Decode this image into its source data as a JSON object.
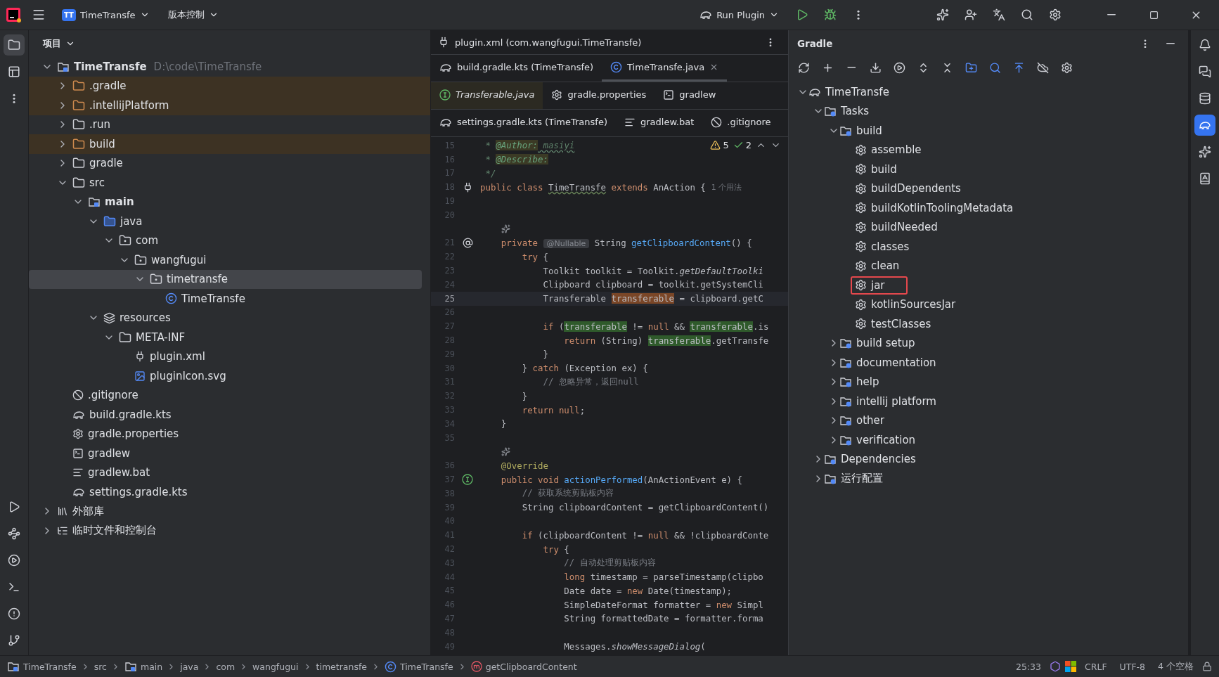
{
  "title_bar": {
    "project_badge": "TT",
    "project": "TimeTransfe",
    "vcs": "版本控制",
    "run_config": "Run Plugin"
  },
  "left_stripe": [
    {
      "kind": "project",
      "selected": true
    },
    {
      "kind": "structure",
      "selected": false
    },
    {
      "kind": "more",
      "selected": false
    }
  ],
  "left_stripe_bottom": [
    {
      "kind": "run",
      "selected": false
    },
    {
      "kind": "services",
      "selected": false
    },
    {
      "kind": "debug",
      "selected": false
    },
    {
      "kind": "terminal",
      "selected": false
    },
    {
      "kind": "problems",
      "selected": false
    },
    {
      "kind": "git",
      "selected": false
    }
  ],
  "project_panel": {
    "title": "项目",
    "tree": [
      {
        "label": "TimeTransfe",
        "kind": "module",
        "path": "D:\\code\\TimeTransfe",
        "expanded": true,
        "selected": false,
        "excluded": false,
        "children": [
          {
            "label": ".gradle",
            "kind": "folder",
            "expanded": false,
            "selected": false,
            "excluded": true
          },
          {
            "label": ".intellijPlatform",
            "kind": "folder",
            "expanded": false,
            "selected": false,
            "excluded": true
          },
          {
            "label": ".run",
            "kind": "folder",
            "expanded": false,
            "selected": false,
            "excluded": false
          },
          {
            "label": "build",
            "kind": "folder",
            "expanded": false,
            "selected": false,
            "excluded": true
          },
          {
            "label": "gradle",
            "kind": "folder",
            "expanded": false,
            "selected": false,
            "excluded": false
          },
          {
            "label": "src",
            "kind": "folder",
            "expanded": true,
            "selected": false,
            "excluded": false,
            "children": [
              {
                "label": "main",
                "kind": "module",
                "expanded": true,
                "selected": false,
                "excluded": false,
                "children": [
                  {
                    "label": "java",
                    "kind": "source",
                    "expanded": true,
                    "selected": false,
                    "excluded": false,
                    "children": [
                      {
                        "label": "com",
                        "kind": "package",
                        "expanded": true,
                        "selected": false,
                        "excluded": false,
                        "children": [
                          {
                            "label": "wangfugui",
                            "kind": "package",
                            "expanded": true,
                            "selected": false,
                            "excluded": false,
                            "children": [
                              {
                                "label": "timetransfe",
                                "kind": "package",
                                "expanded": true,
                                "selected": true,
                                "excluded": false,
                                "children": [
                                  {
                                    "label": "TimeTransfe",
                                    "kind": "class",
                                    "selected": false,
                                    "excluded": false
                                  }
                                ]
                              }
                            ]
                          }
                        ]
                      }
                    ]
                  },
                  {
                    "label": "resources",
                    "kind": "resources",
                    "expanded": true,
                    "selected": false,
                    "excluded": false,
                    "children": [
                      {
                        "label": "META-INF",
                        "kind": "folder",
                        "expanded": true,
                        "selected": false,
                        "excluded": false,
                        "children": [
                          {
                            "label": "plugin.xml",
                            "kind": "plugin",
                            "selected": false,
                            "excluded": false
                          },
                          {
                            "label": "pluginIcon.svg",
                            "kind": "image",
                            "selected": false,
                            "excluded": false
                          }
                        ]
                      }
                    ]
                  }
                ]
              }
            ]
          },
          {
            "label": ".gitignore",
            "kind": "ignore",
            "selected": false,
            "excluded": false
          },
          {
            "label": "build.gradle.kts",
            "kind": "gradle",
            "selected": false,
            "excluded": false
          },
          {
            "label": "gradle.properties",
            "kind": "settings",
            "selected": false,
            "excluded": false
          },
          {
            "label": "gradlew",
            "kind": "terminal",
            "selected": false,
            "excluded": false
          },
          {
            "label": "gradlew.bat",
            "kind": "text",
            "selected": false,
            "excluded": false
          },
          {
            "label": "settings.gradle.kts",
            "kind": "gradle",
            "selected": false,
            "excluded": false
          }
        ]
      },
      {
        "label": "外部库",
        "kind": "library",
        "expanded": false,
        "selected": false,
        "excluded": false
      },
      {
        "label": "临时文件和控制台",
        "kind": "scratch",
        "expanded": false,
        "selected": false,
        "excluded": false
      }
    ]
  },
  "editor": {
    "file_path": "plugin.xml (com.wangfugui.TimeTransfe)",
    "tab_rows": [
      [
        {
          "label": "build.gradle.kts (TimeTransfe)",
          "kind": "gradle",
          "selected": false,
          "preview": false
        },
        {
          "label": "TimeTransfe.java",
          "kind": "class",
          "selected": true,
          "preview": false
        }
      ],
      [
        {
          "label": "Transferable.java",
          "kind": "interface",
          "selected": false,
          "preview": true
        },
        {
          "label": "gradle.properties",
          "kind": "settings",
          "selected": false,
          "preview": false
        },
        {
          "label": "gradlew",
          "kind": "terminal",
          "selected": false,
          "preview": false
        }
      ],
      [
        {
          "label": "settings.gradle.kts (TimeTransfe)",
          "kind": "gradle",
          "selected": false,
          "preview": false
        },
        {
          "label": "gradlew.bat",
          "kind": "text",
          "selected": false,
          "preview": false
        },
        {
          "label": ".gitignore",
          "kind": "ignore",
          "selected": false,
          "preview": false
        }
      ]
    ],
    "inspections": {
      "warnings": "5",
      "weak_warnings": "2"
    },
    "lines": [
      {
        "kind": "code",
        "number": "15",
        "current": false,
        "segments": [
          {
            "kind": "doc",
            "text": " * "
          },
          {
            "kind": "doctag",
            "text": "@Author:"
          },
          {
            "kind": "typo",
            "text": " masiyi"
          }
        ]
      },
      {
        "kind": "code",
        "number": "16",
        "current": false,
        "segments": [
          {
            "kind": "doc",
            "text": " * "
          },
          {
            "kind": "doctag",
            "text": "@Describe:"
          }
        ]
      },
      {
        "kind": "code",
        "number": "17",
        "current": false,
        "segments": [
          {
            "kind": "doc",
            "text": " */"
          }
        ]
      },
      {
        "kind": "code",
        "number": "18",
        "current": false,
        "marker": {
          "kind": "plug"
        },
        "segments": [
          {
            "kind": "kw",
            "text": "public class "
          },
          {
            "kind": "typo-plain",
            "text": "TimeTransfe"
          },
          {
            "kind": "kw",
            "text": " extends "
          },
          {
            "kind": "plain",
            "text": "AnAction {"
          }
        ],
        "usage": "1 个用法"
      },
      {
        "kind": "code",
        "number": "19",
        "current": false
      },
      {
        "kind": "code",
        "number": "20",
        "current": false
      },
      {
        "kind": "inlay"
      },
      {
        "kind": "code",
        "number": "21",
        "current": false,
        "marker": {
          "kind": "at"
        },
        "segments": [
          {
            "kind": "kw",
            "text": "    private "
          },
          {
            "kind": "hint",
            "text": "@Nullable"
          },
          {
            "kind": "plain",
            "text": " String "
          },
          {
            "kind": "method",
            "text": "getClipboardContent"
          },
          {
            "kind": "plain",
            "text": "() {"
          }
        ]
      },
      {
        "kind": "code",
        "number": "22",
        "current": false,
        "segments": [
          {
            "kind": "kw",
            "text": "        try "
          },
          {
            "kind": "plain",
            "text": "{"
          }
        ]
      },
      {
        "kind": "code",
        "number": "23",
        "current": false,
        "segments": [
          {
            "kind": "plain",
            "text": "            Toolkit toolkit = Toolkit."
          },
          {
            "kind": "static",
            "text": "getDefaultToolki"
          }
        ]
      },
      {
        "kind": "code",
        "number": "24",
        "current": false,
        "segments": [
          {
            "kind": "plain",
            "text": "            Clipboard clipboard = toolkit.getSystemCli"
          }
        ]
      },
      {
        "kind": "code",
        "number": "25",
        "current": true,
        "segments": [
          {
            "kind": "plain",
            "text": "            Transferable "
          },
          {
            "kind": "write",
            "text": "transferable"
          },
          {
            "kind": "plain",
            "text": " = clipboard.getC"
          }
        ]
      },
      {
        "kind": "code",
        "number": "26",
        "current": false
      },
      {
        "kind": "code",
        "number": "27",
        "current": false,
        "segments": [
          {
            "kind": "kw",
            "text": "            if "
          },
          {
            "kind": "plain",
            "text": "("
          },
          {
            "kind": "read",
            "text": "transferable"
          },
          {
            "kind": "plain",
            "text": " != "
          },
          {
            "kind": "kw",
            "text": "null"
          },
          {
            "kind": "plain",
            "text": " && "
          },
          {
            "kind": "read",
            "text": "transferable"
          },
          {
            "kind": "plain",
            "text": ".is"
          }
        ]
      },
      {
        "kind": "code",
        "number": "28",
        "current": false,
        "segments": [
          {
            "kind": "kw",
            "text": "                return "
          },
          {
            "kind": "plain",
            "text": "(String) "
          },
          {
            "kind": "read",
            "text": "transferable"
          },
          {
            "kind": "plain",
            "text": ".getTransfe"
          }
        ]
      },
      {
        "kind": "code",
        "number": "29",
        "current": false,
        "segments": [
          {
            "kind": "plain",
            "text": "            }"
          }
        ]
      },
      {
        "kind": "code",
        "number": "30",
        "current": false,
        "segments": [
          {
            "kind": "plain",
            "text": "        } "
          },
          {
            "kind": "kw",
            "text": "catch "
          },
          {
            "kind": "plain",
            "text": "(Exception ex) {"
          }
        ]
      },
      {
        "kind": "code",
        "number": "31",
        "current": false,
        "segments": [
          {
            "kind": "comment",
            "text": "            // 忽略异常，返回null"
          }
        ]
      },
      {
        "kind": "code",
        "number": "32",
        "current": false,
        "segments": [
          {
            "kind": "plain",
            "text": "        }"
          }
        ]
      },
      {
        "kind": "code",
        "number": "33",
        "current": false,
        "segments": [
          {
            "kind": "kw",
            "text": "        return null"
          },
          {
            "kind": "plain",
            "text": ";"
          }
        ]
      },
      {
        "kind": "code",
        "number": "34",
        "current": false,
        "segments": [
          {
            "kind": "plain",
            "text": "    }"
          }
        ]
      },
      {
        "kind": "code",
        "number": "35",
        "current": false
      },
      {
        "kind": "inlay"
      },
      {
        "kind": "code",
        "number": "36",
        "current": false,
        "segments": [
          {
            "kind": "annotation",
            "text": "    @Override"
          }
        ]
      },
      {
        "kind": "code",
        "number": "37",
        "current": false,
        "marker": {
          "kind": "implements"
        },
        "segments": [
          {
            "kind": "kw",
            "text": "    public void "
          },
          {
            "kind": "method",
            "text": "actionPerformed"
          },
          {
            "kind": "plain",
            "text": "(AnActionEvent e) {"
          }
        ]
      },
      {
        "kind": "code",
        "number": "38",
        "current": false,
        "segments": [
          {
            "kind": "comment",
            "text": "        // 获取系统剪贴板内容"
          }
        ]
      },
      {
        "kind": "code",
        "number": "39",
        "current": false,
        "segments": [
          {
            "kind": "plain",
            "text": "        String clipboardContent = getClipboardContent()"
          }
        ]
      },
      {
        "kind": "code",
        "number": "40",
        "current": false
      },
      {
        "kind": "code",
        "number": "41",
        "current": false,
        "segments": [
          {
            "kind": "kw",
            "text": "        if "
          },
          {
            "kind": "plain",
            "text": "(clipboardContent != "
          },
          {
            "kind": "kw",
            "text": "null"
          },
          {
            "kind": "plain",
            "text": " && !clipboardConte"
          }
        ]
      },
      {
        "kind": "code",
        "number": "42",
        "current": false,
        "segments": [
          {
            "kind": "kw",
            "text": "            try "
          },
          {
            "kind": "plain",
            "text": "{"
          }
        ]
      },
      {
        "kind": "code",
        "number": "43",
        "current": false,
        "segments": [
          {
            "kind": "comment",
            "text": "                // 自动处理剪贴板内容"
          }
        ]
      },
      {
        "kind": "code",
        "number": "44",
        "current": false,
        "segments": [
          {
            "kind": "kw",
            "text": "                long "
          },
          {
            "kind": "plain",
            "text": "timestamp = parseTimestamp(clipbo"
          }
        ]
      },
      {
        "kind": "code",
        "number": "45",
        "current": false,
        "segments": [
          {
            "kind": "plain",
            "text": "                Date date = "
          },
          {
            "kind": "kw",
            "text": "new "
          },
          {
            "kind": "plain",
            "text": "Date(timestamp);"
          }
        ]
      },
      {
        "kind": "code",
        "number": "46",
        "current": false,
        "segments": [
          {
            "kind": "plain",
            "text": "                SimpleDateFormat formatter = "
          },
          {
            "kind": "kw",
            "text": "new "
          },
          {
            "kind": "plain",
            "text": "Simpl"
          }
        ]
      },
      {
        "kind": "code",
        "number": "47",
        "current": false,
        "segments": [
          {
            "kind": "plain",
            "text": "                String formattedDate = formatter.forma"
          }
        ]
      },
      {
        "kind": "code",
        "number": "48",
        "current": false
      },
      {
        "kind": "code",
        "number": "49",
        "current": false,
        "segments": [
          {
            "kind": "plain",
            "text": "                Messages."
          },
          {
            "kind": "static",
            "text": "showMessageDialog"
          },
          {
            "kind": "plain",
            "text": "("
          }
        ]
      }
    ]
  },
  "gradle_panel": {
    "title": "Gradle",
    "tree": [
      {
        "label": "TimeTransfe",
        "kind": "project",
        "expanded": true,
        "selected": false,
        "outlined": false,
        "children": [
          {
            "label": "Tasks",
            "kind": "group",
            "expanded": true,
            "selected": false,
            "outlined": false,
            "children": [
              {
                "label": "build",
                "kind": "group",
                "expanded": true,
                "selected": false,
                "outlined": false,
                "children": [
                  {
                    "label": "assemble",
                    "kind": "task",
                    "selected": false,
                    "outlined": false
                  },
                  {
                    "label": "build",
                    "kind": "task",
                    "selected": false,
                    "outlined": false
                  },
                  {
                    "label": "buildDependents",
                    "kind": "task",
                    "selected": false,
                    "outlined": false
                  },
                  {
                    "label": "buildKotlinToolingMetadata",
                    "kind": "task",
                    "selected": false,
                    "outlined": false
                  },
                  {
                    "label": "buildNeeded",
                    "kind": "task",
                    "selected": false,
                    "outlined": false
                  },
                  {
                    "label": "classes",
                    "kind": "task",
                    "selected": false,
                    "outlined": false
                  },
                  {
                    "label": "clean",
                    "kind": "task",
                    "selected": false,
                    "outlined": false
                  },
                  {
                    "label": "jar",
                    "kind": "task",
                    "selected": false,
                    "outlined": true
                  },
                  {
                    "label": "kotlinSourcesJar",
                    "kind": "task",
                    "selected": false,
                    "outlined": false
                  },
                  {
                    "label": "testClasses",
                    "kind": "task",
                    "selected": false,
                    "outlined": false
                  }
                ]
              },
              {
                "label": "build setup",
                "kind": "group",
                "expanded": false,
                "selected": false,
                "outlined": false
              },
              {
                "label": "documentation",
                "kind": "group",
                "expanded": false,
                "selected": false,
                "outlined": false
              },
              {
                "label": "help",
                "kind": "group",
                "expanded": false,
                "selected": false,
                "outlined": false
              },
              {
                "label": "intellij platform",
                "kind": "group",
                "expanded": false,
                "selected": false,
                "outlined": false
              },
              {
                "label": "other",
                "kind": "group",
                "expanded": false,
                "selected": false,
                "outlined": false
              },
              {
                "label": "verification",
                "kind": "group",
                "expanded": false,
                "selected": false,
                "outlined": false
              }
            ]
          },
          {
            "label": "Dependencies",
            "kind": "group",
            "expanded": false,
            "selected": false,
            "outlined": false
          },
          {
            "label": "运行配置",
            "kind": "group",
            "expanded": false,
            "selected": false,
            "outlined": false
          }
        ]
      }
    ]
  },
  "right_stripe": [
    {
      "kind": "notifications",
      "selected": false
    },
    {
      "kind": "chat",
      "selected": false
    },
    {
      "kind": "database",
      "selected": false
    },
    {
      "kind": "gradle",
      "selected": true
    },
    {
      "kind": "ai",
      "selected": false
    },
    {
      "kind": "docs",
      "selected": false
    }
  ],
  "status_bar": {
    "breadcrumbs": [
      {
        "label": "TimeTransfe",
        "kind": "module"
      },
      {
        "label": "src",
        "kind": "plain"
      },
      {
        "label": "main",
        "kind": "module"
      },
      {
        "label": "java",
        "kind": "plain"
      },
      {
        "label": "com",
        "kind": "plain"
      },
      {
        "label": "wangfugui",
        "kind": "plain"
      },
      {
        "label": "timetransfe",
        "kind": "plain"
      },
      {
        "label": "TimeTransfe",
        "kind": "class"
      },
      {
        "label": "getClipboardContent",
        "kind": "method"
      }
    ],
    "position": "25:33",
    "line_separator": "CRLF",
    "encoding": "UTF-8",
    "indent": "4 个空格"
  }
}
